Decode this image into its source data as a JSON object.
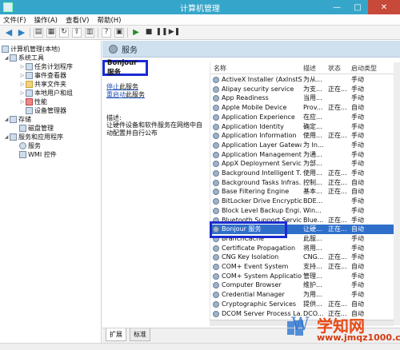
{
  "window": {
    "title": "计算机管理",
    "controls": [
      "—",
      "□",
      "✕"
    ]
  },
  "menu": [
    "文件(F)",
    "操作(A)",
    "查看(V)",
    "帮助(H)"
  ],
  "toolbar_icons": [
    "back-arrow-icon",
    "forward-arrow-icon",
    "folder-up-icon",
    "properties-icon",
    "refresh-icon",
    "export-icon",
    "help-icon",
    "show-pane-icon",
    "play-icon",
    "stop-icon",
    "pause-icon",
    "restart-icon"
  ],
  "tree": {
    "root": "计算机管理(本地)",
    "system_tools": "系统工具",
    "task_scheduler": "任务计划程序",
    "event_viewer": "事件查看器",
    "shared_folders": "共享文件夹",
    "local_users": "本地用户和组",
    "performance": "性能",
    "device_manager": "设备管理器",
    "storage": "存储",
    "disk_management": "磁盘管理",
    "services_apps": "服务和应用程序",
    "services": "服务",
    "wmi": "WMI 控件"
  },
  "pane": {
    "header": "服务",
    "selected_title": "Bonjour 服务",
    "stop_link": "停止",
    "stop_rest": "此服务",
    "restart_link": "重启动",
    "restart_rest": "此服务",
    "desc_label": "描述:",
    "desc_text": "让硬件设备和软件服务在网络中自动配置并自行公布"
  },
  "list": {
    "columns": [
      "名称",
      "描述",
      "状态",
      "启动类型"
    ],
    "rows": [
      [
        "ActiveX Installer (AxInstSV)",
        "为从...",
        "",
        "手动"
      ],
      [
        "Alipay security service",
        "为支...",
        "正在...",
        "手动"
      ],
      [
        "App Readiness",
        "当用...",
        "",
        "手动"
      ],
      [
        "Apple Mobile Device",
        "Prov...",
        "正在...",
        "自动"
      ],
      [
        "Application Experience",
        "在应...",
        "",
        "手动"
      ],
      [
        "Application Identity",
        "确定...",
        "",
        "手动"
      ],
      [
        "Application Information",
        "使用...",
        "正在...",
        "手动"
      ],
      [
        "Application Layer Gatewa...",
        "为 In...",
        "",
        "手动"
      ],
      [
        "Application Management",
        "为通...",
        "",
        "手动"
      ],
      [
        "AppX Deployment Servic...",
        "为部...",
        "",
        "手动"
      ],
      [
        "Background Intelligent T...",
        "使用...",
        "正在...",
        "手动"
      ],
      [
        "Background Tasks Infras...",
        "控制...",
        "正在...",
        "自动"
      ],
      [
        "Base Filtering Engine",
        "基本...",
        "正在...",
        "自动"
      ],
      [
        "BitLocker Drive Encryptio...",
        "BDE...",
        "",
        "手动"
      ],
      [
        "Block Level Backup Engi...",
        "Win...",
        "",
        "手动"
      ],
      [
        "Bluetooth Support Service",
        "Blue...",
        "正在...",
        "手动"
      ],
      [
        "Bonjour 服务",
        "让硬...",
        "正在...",
        "自动"
      ],
      [
        "BranchCache",
        "此服...",
        "",
        "手动"
      ],
      [
        "Certificate Propagation",
        "将用...",
        "",
        "手动"
      ],
      [
        "CNG Key Isolation",
        "CNG...",
        "正在...",
        "手动"
      ],
      [
        "COM+ Event System",
        "支持...",
        "正在...",
        "自动"
      ],
      [
        "COM+ System Application",
        "管理...",
        "",
        "手动"
      ],
      [
        "Computer Browser",
        "维护...",
        "",
        "手动"
      ],
      [
        "Credential Manager",
        "为用...",
        "",
        "手动"
      ],
      [
        "Cryptographic Services",
        "提供...",
        "正在...",
        "自动"
      ],
      [
        "DCOM Server Process La...",
        "DCO...",
        "正在...",
        "自动"
      ]
    ],
    "selected_index": 16
  },
  "tabs": [
    "扩展",
    "标准"
  ],
  "watermark": {
    "brand": "学知网",
    "site": "www.jmqz1000.com",
    "logo_letter": "W"
  }
}
